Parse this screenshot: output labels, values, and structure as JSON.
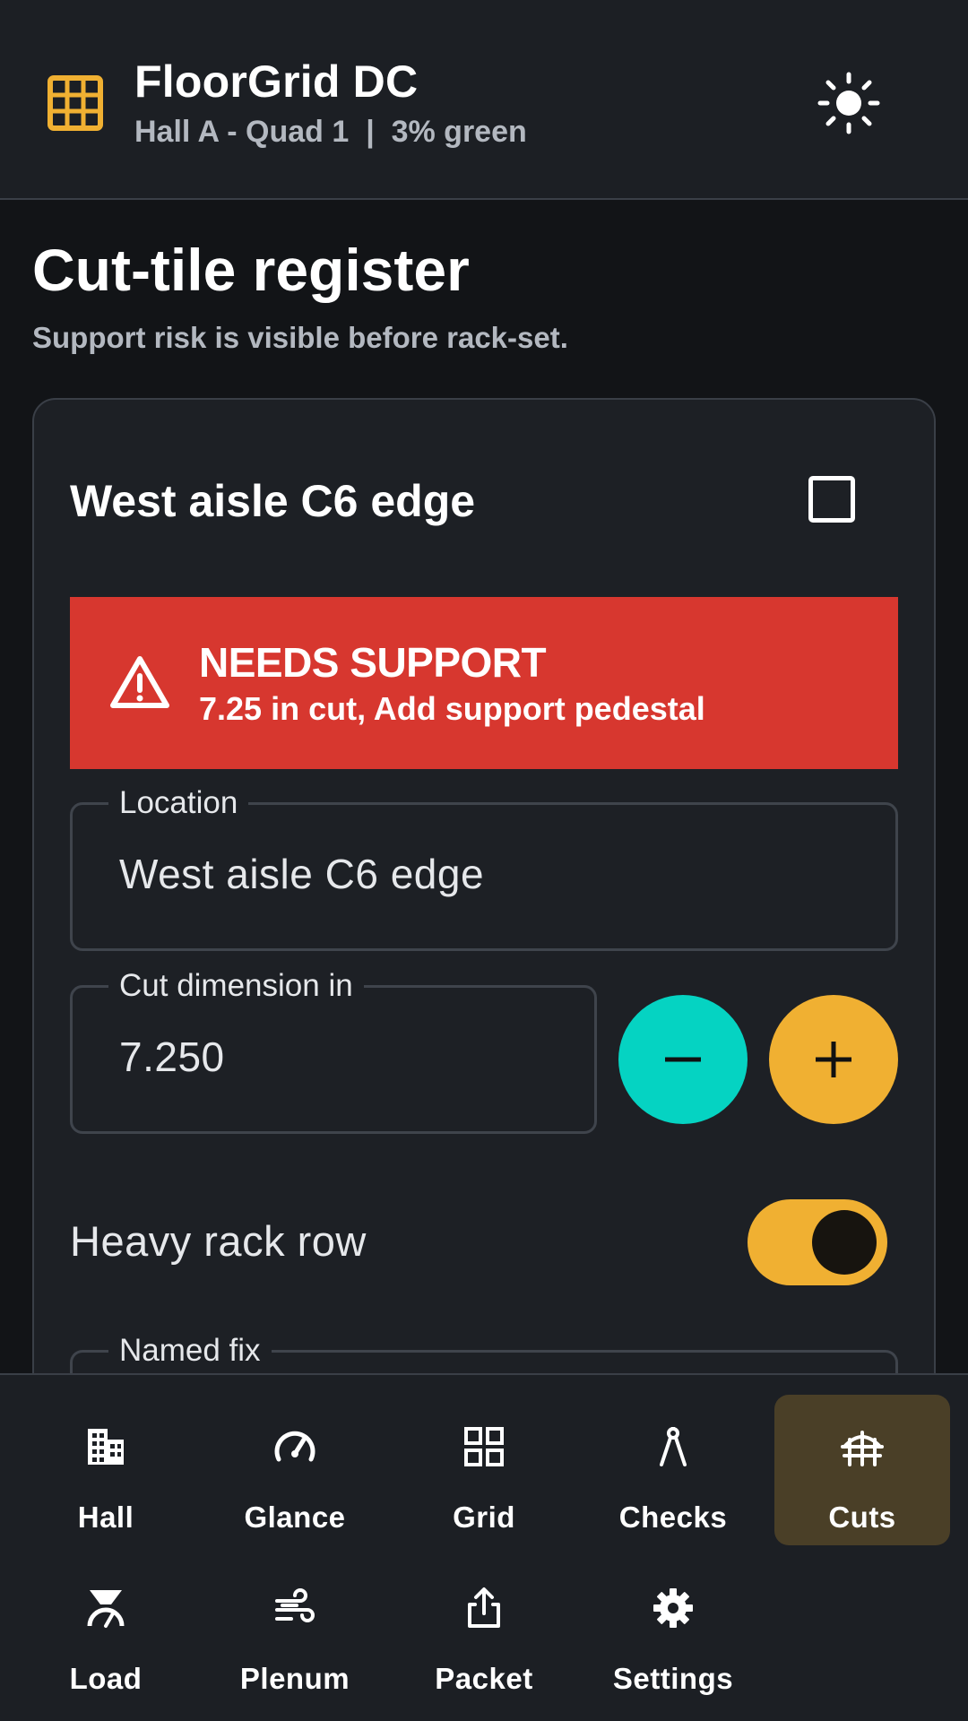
{
  "header": {
    "title": "FloorGrid DC",
    "subtitle": "Hall A - Quad 1  |  3% green",
    "logo_icon": "grid-icon",
    "theme_icon": "sun-icon"
  },
  "page": {
    "title": "Cut-tile register",
    "subtitle": "Support risk is visible before rack-set."
  },
  "card": {
    "title": "West aisle C6 edge",
    "selected": false,
    "alert": {
      "title": "NEEDS SUPPORT",
      "detail": "7.25 in cut, Add support pedestal",
      "icon": "warning-icon",
      "color": "#d7372f"
    },
    "location": {
      "label": "Location",
      "value": "West aisle C6 edge"
    },
    "cut_dimension": {
      "label": "Cut dimension in",
      "value": "7.250"
    },
    "decrement_icon": "minus-icon",
    "increment_icon": "plus-icon",
    "heavy_rack": {
      "label": "Heavy rack row",
      "on": true
    },
    "named_fix": {
      "label": "Named fix"
    }
  },
  "nav": {
    "items": [
      {
        "label": "Hall",
        "icon": "building-icon"
      },
      {
        "label": "Glance",
        "icon": "gauge-icon"
      },
      {
        "label": "Grid",
        "icon": "grid-icon"
      },
      {
        "label": "Checks",
        "icon": "compass-icon"
      },
      {
        "label": "Cuts",
        "icon": "cut-tile-icon",
        "active": true
      },
      {
        "label": "Load",
        "icon": "scale-icon"
      },
      {
        "label": "Plenum",
        "icon": "airflow-icon"
      },
      {
        "label": "Packet",
        "icon": "share-icon"
      },
      {
        "label": "Settings",
        "icon": "gear-icon"
      }
    ]
  },
  "colors": {
    "accent": "#f0b032",
    "teal": "#05d3c2",
    "danger": "#d7372f",
    "background": "#121417",
    "surface": "#1d2025"
  }
}
